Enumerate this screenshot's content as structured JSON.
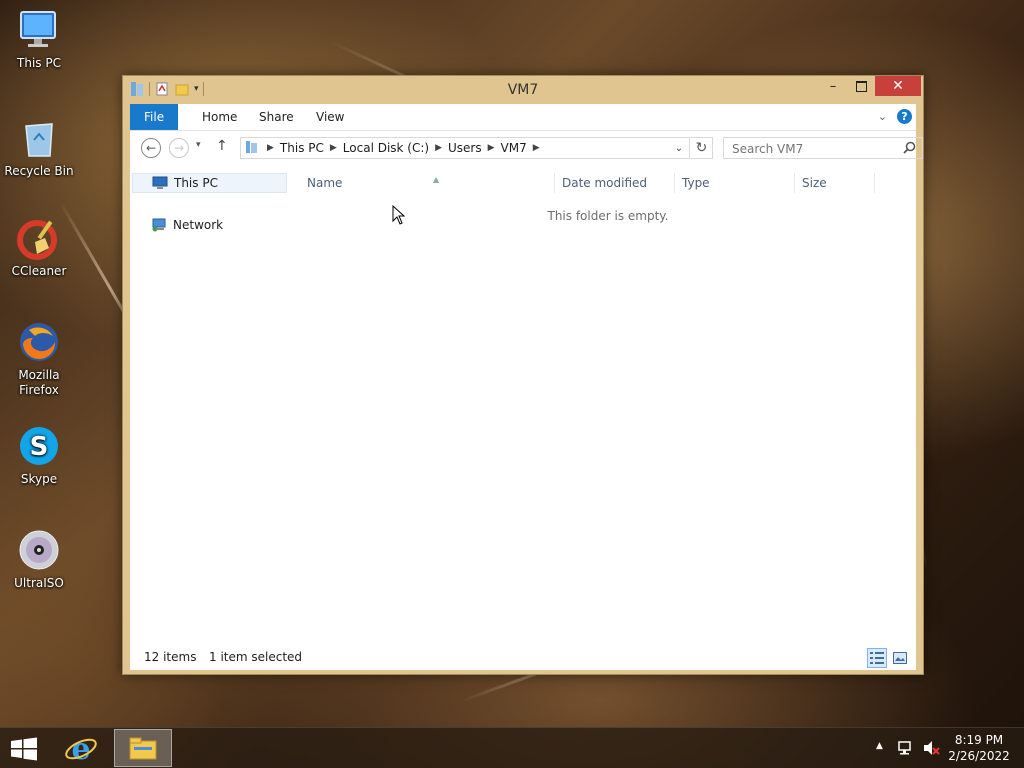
{
  "desktop": {
    "icons": [
      {
        "label": "This PC"
      },
      {
        "label": "Recycle Bin"
      },
      {
        "label": "CCleaner"
      },
      {
        "label": "Mozilla Firefox"
      },
      {
        "label": "Skype"
      },
      {
        "label": "UltraISO"
      }
    ]
  },
  "window": {
    "title": "VM7",
    "ribbon": {
      "tabs": [
        "File",
        "Home",
        "Share",
        "View"
      ]
    },
    "address": {
      "crumbs": [
        "This PC",
        "Local Disk (C:)",
        "Users",
        "VM7"
      ]
    },
    "search": {
      "placeholder": "Search VM7"
    },
    "nav_pane": {
      "items": [
        "This PC",
        "Network"
      ]
    },
    "columns": [
      "Name",
      "Date modified",
      "Type",
      "Size"
    ],
    "empty_message": "This folder is empty.",
    "status": {
      "items_count": "12 items",
      "selected": "1 item selected"
    }
  },
  "taskbar": {
    "clock": {
      "time": "8:19 PM",
      "date": "2/26/2022"
    }
  },
  "colors": {
    "accent": "#1979ca",
    "window_frame": "#e0c590",
    "close_button": "#c7403c"
  }
}
